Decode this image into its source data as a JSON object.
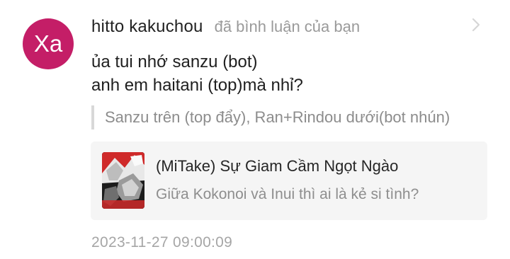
{
  "notification": {
    "avatar_initials": "Xa",
    "avatar_color": "#c41e67",
    "username": "hitto kakuchou",
    "action_text": "đã bình luận của bạn",
    "chevron_icon": "chevron-right-icon",
    "comment_text": "ủa tui nhớ sanzu (bot)\nanh em haitani (top)mà nhỉ?",
    "quoted_text": "Sanzu trên (top đẩy), Ran+Rindou dưới(bot nhún)",
    "post": {
      "thumbnail_icon": "manga-cover-thumbnail",
      "title": "(MiTake) Sự Giam Cầm Ngọt Ngào",
      "subtitle": "Giữa Kokonoi và Inui thì ai là kẻ si tình?"
    },
    "timestamp": "2023-11-27 09:00:09"
  }
}
